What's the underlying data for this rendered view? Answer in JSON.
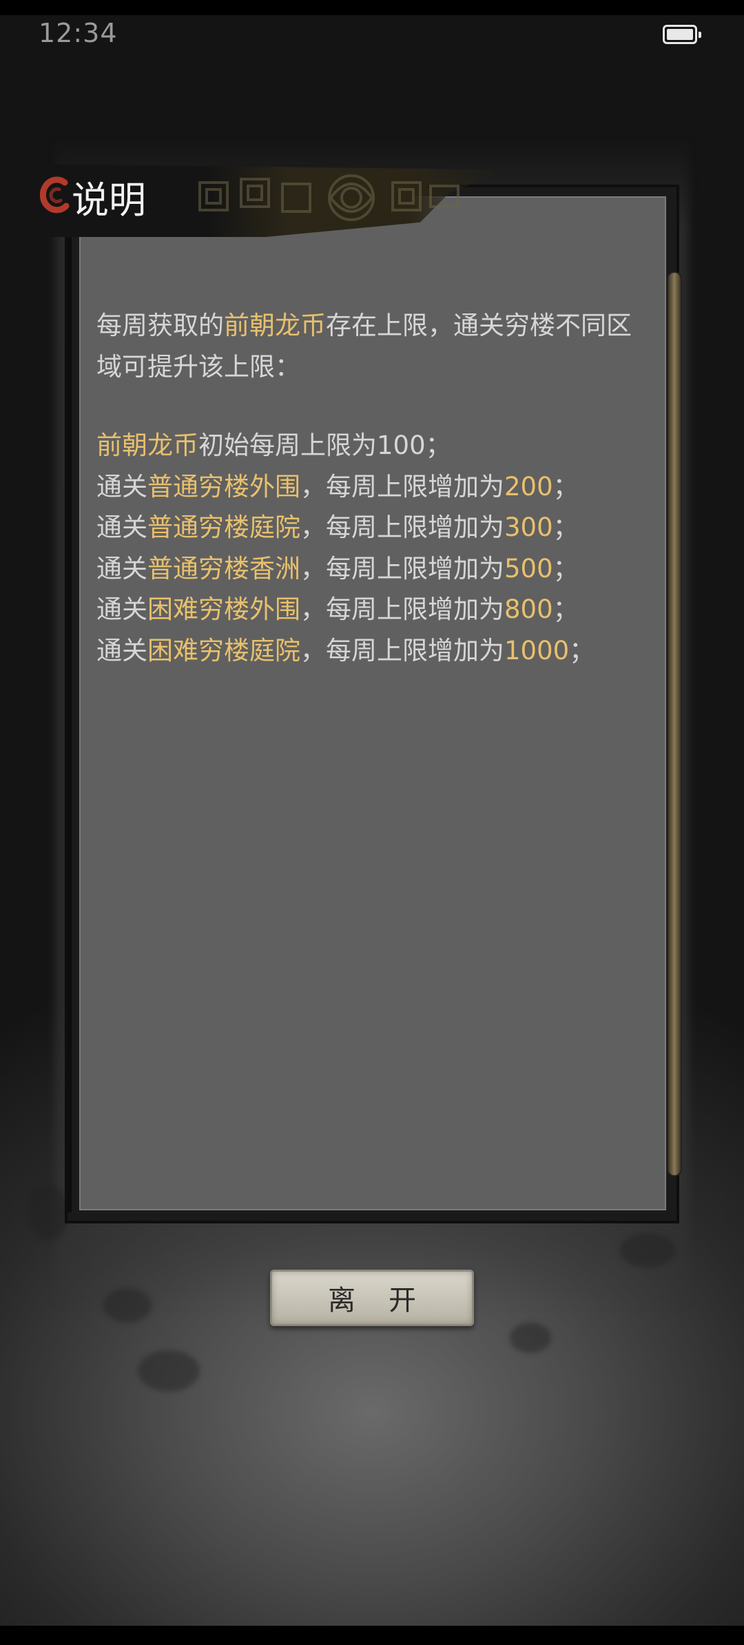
{
  "status_bar": {
    "time": "12:34",
    "battery_icon": "battery-charging-icon"
  },
  "dialog": {
    "title": "说明",
    "emblem_icon": "swirl-emblem-icon",
    "intro": {
      "before": "每周获取的",
      "highlight": "前朝龙币",
      "after": "存在上限，通关穷楼不同区域可提升该上限："
    },
    "base_line": {
      "highlight": "前朝龙币",
      "after": "初始每周上限为100；"
    },
    "rules": [
      {
        "prefix": "通关",
        "area": "普通穷楼外围",
        "middle": "，每周上限增加为",
        "value": "200",
        "suffix": "；"
      },
      {
        "prefix": "通关",
        "area": "普通穷楼庭院",
        "middle": "，每周上限增加为",
        "value": "300",
        "suffix": "；"
      },
      {
        "prefix": "通关",
        "area": "普通穷楼香洲",
        "middle": "，每周上限增加为",
        "value": "500",
        "suffix": "；"
      },
      {
        "prefix": "通关",
        "area": "困难穷楼外围",
        "middle": "，每周上限增加为",
        "value": "800",
        "suffix": "；"
      },
      {
        "prefix": "通关",
        "area": "困难穷楼庭院",
        "middle": "，每周上限增加为",
        "value": "1000",
        "suffix": "；"
      }
    ]
  },
  "leave_button": {
    "label": "离开"
  },
  "colors": {
    "highlight": "#e8c06d",
    "body_text": "#d6d6d6",
    "panel_bg": "#606060",
    "button_bg": "#cfcbbf"
  }
}
